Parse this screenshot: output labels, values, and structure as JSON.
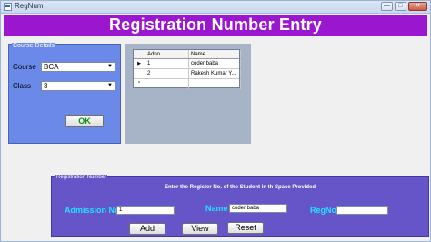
{
  "window": {
    "title": "RegNum",
    "controls": [
      "—",
      "□",
      "✕"
    ]
  },
  "banner": {
    "title": "Registration Number Entry"
  },
  "course_details": {
    "legend": "Course Details",
    "course_label": "Course",
    "course_value": "BCA",
    "class_label": "Class",
    "class_value": "3",
    "ok_label": "OK"
  },
  "grid": {
    "columns": [
      "Adno",
      "Name"
    ],
    "rows": [
      {
        "marker": "▶",
        "adno": "1",
        "name": "coder baba"
      },
      {
        "marker": "",
        "adno": "2",
        "name": "Rakesh Kumar Y..."
      },
      {
        "marker": "*",
        "adno": "",
        "name": ""
      }
    ]
  },
  "registration": {
    "legend": "Registration Number",
    "instruction": "Enter the Register No. of the Student in th Space Provided",
    "admission_label": "Admission No",
    "admission_value": "1",
    "name_label": "Name",
    "name_value": "coder baba",
    "regno_label": "RegNo",
    "regno_value": "",
    "add_label": "Add",
    "view_label": "View",
    "reset_label": "Reset"
  },
  "colors": {
    "banner": "#9b16cf",
    "course_panel": "#6b89e8",
    "registration_panel": "#6655c9",
    "label_accent": "#1fe3ff",
    "ok_text": "#138a13"
  }
}
